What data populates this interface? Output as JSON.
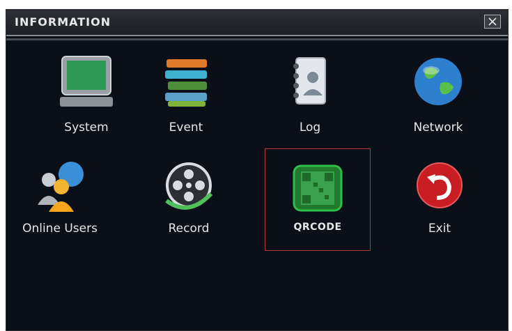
{
  "window": {
    "title": "INFORMATION",
    "close_icon": "close-icon"
  },
  "menu": {
    "items": [
      {
        "label": "System",
        "icon": "monitor-icon"
      },
      {
        "label": "Event",
        "icon": "books-icon"
      },
      {
        "label": "Log",
        "icon": "address-book-icon"
      },
      {
        "label": "Network",
        "icon": "globe-icon"
      },
      {
        "label": "Online Users",
        "icon": "users-icon"
      },
      {
        "label": "Record",
        "icon": "film-reel-icon"
      },
      {
        "label": "QRCODE",
        "icon": "qrcode-icon",
        "selected": true
      },
      {
        "label": "Exit",
        "icon": "exit-icon"
      }
    ]
  },
  "colors": {
    "background": "#0b0f17",
    "selection_border": "#b23a3a",
    "title_text": "#e8e8e8"
  }
}
